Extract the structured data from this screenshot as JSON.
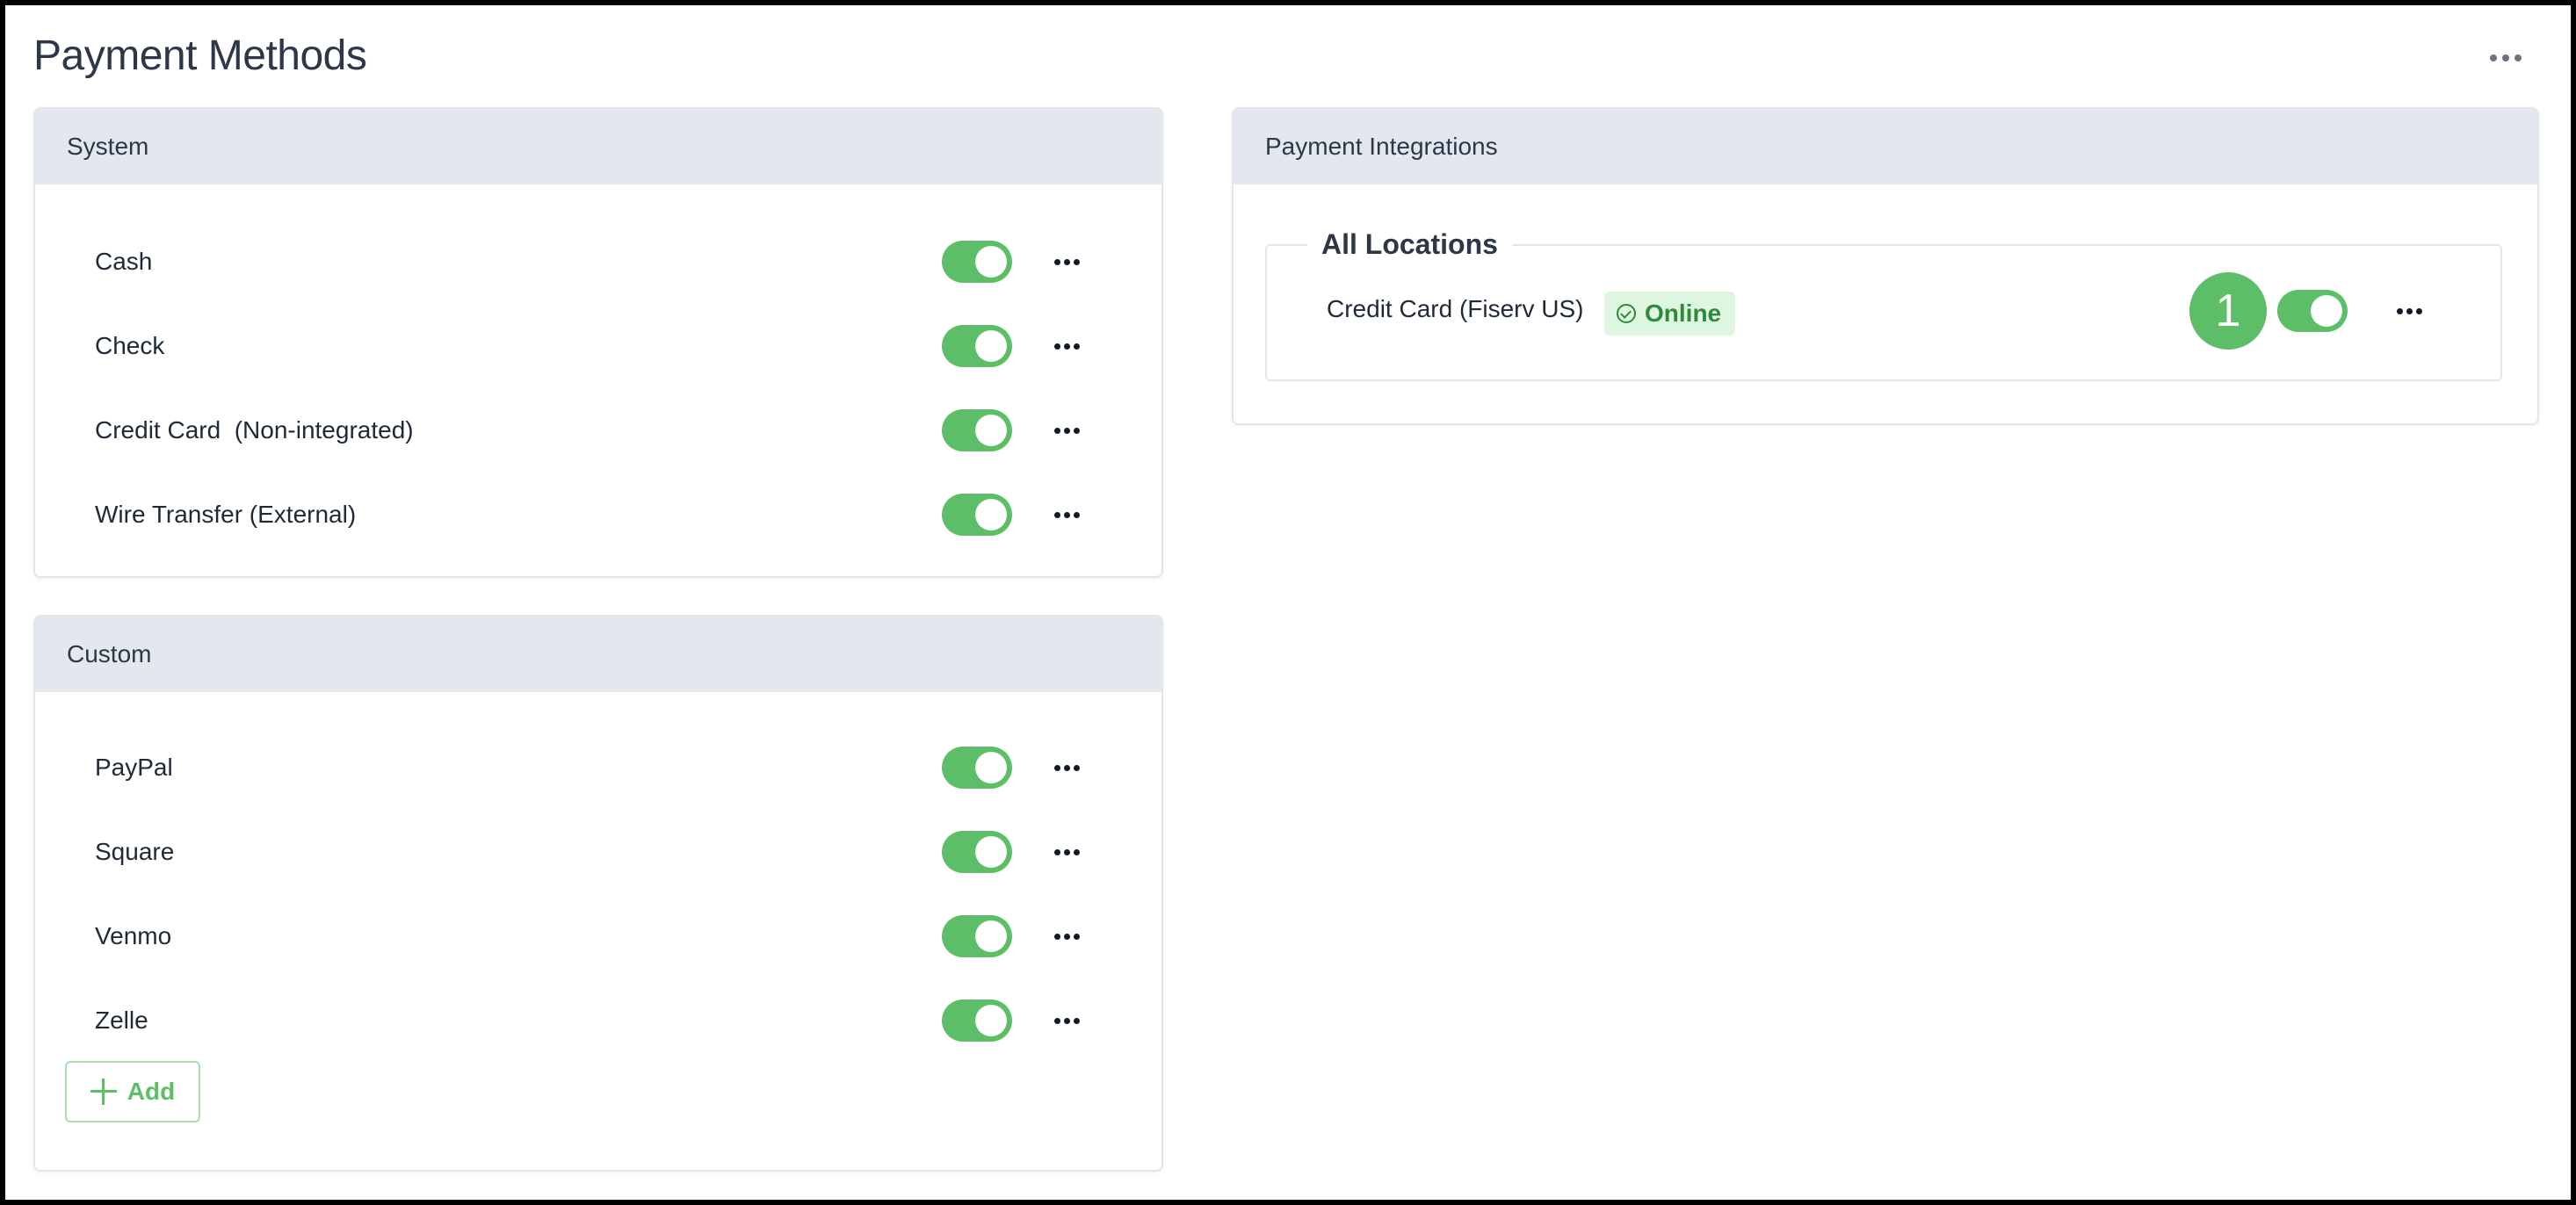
{
  "page": {
    "title": "Payment Methods",
    "more_icon": "more-horizontal-icon"
  },
  "system": {
    "heading": "System",
    "items": [
      {
        "label": "Cash",
        "enabled": true
      },
      {
        "label": "Check",
        "enabled": true
      },
      {
        "label": "Credit Card  (Non-integrated)",
        "enabled": true
      },
      {
        "label": "Wire Transfer (External)",
        "enabled": true
      }
    ]
  },
  "custom": {
    "heading": "Custom",
    "items": [
      {
        "label": "PayPal",
        "enabled": true
      },
      {
        "label": "Square",
        "enabled": true
      },
      {
        "label": "Venmo",
        "enabled": true
      },
      {
        "label": "Zelle",
        "enabled": true
      }
    ],
    "add_label": "Add",
    "add_icon": "plus-icon"
  },
  "integrations": {
    "heading": "Payment Integrations",
    "group_label": "All Locations",
    "items": [
      {
        "label": "Credit Card (Fiserv US)",
        "status": "Online",
        "status_icon": "check-circle-icon",
        "marker": "1",
        "enabled": true
      }
    ]
  },
  "colors": {
    "accent_green": "#5cbf67",
    "status_text_green": "#2f8a3d",
    "status_badge_bg": "#def5e0",
    "card_header_bg": "#e3e8ef"
  }
}
